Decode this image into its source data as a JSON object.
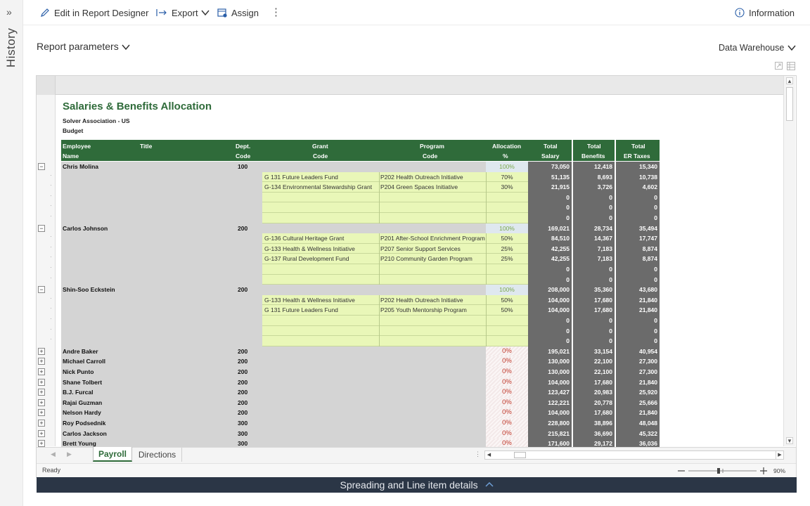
{
  "history": {
    "label": "History",
    "expand_icon": "double-chevron-right-icon"
  },
  "toolbar": {
    "edit_label": "Edit in Report Designer",
    "export_label": "Export",
    "assign_label": "Assign",
    "more_icon": "more-vertical-icon",
    "info_label": "Information"
  },
  "params": {
    "report_params_label": "Report parameters",
    "data_source_label": "Data Warehouse"
  },
  "report": {
    "title": "Salaries & Benefits Allocation",
    "org": "Solver Association - US",
    "scenario": "Budget",
    "headers": {
      "employee": [
        "Employee",
        "Name"
      ],
      "title": "Title",
      "dept": [
        "Dept.",
        "Code"
      ],
      "grant": [
        "Grant",
        "Code"
      ],
      "program": [
        "Program",
        "Code"
      ],
      "allocation": [
        "Allocation",
        "%"
      ],
      "salary": [
        "Total",
        "Salary"
      ],
      "benefits": [
        "Total",
        "Benefits"
      ],
      "taxes": [
        "Total",
        "ER Taxes"
      ]
    },
    "rows": [
      {
        "type": "emp",
        "name": "Chris Molina",
        "dept": "100",
        "alloc": "100%",
        "salary": "73,050",
        "benefits": "12,418",
        "taxes": "15,340"
      },
      {
        "type": "det",
        "grant": "G 131 Future Leaders Fund",
        "program": "P202 Health Outreach Initiative",
        "alloc": "70%",
        "salary": "51,135",
        "benefits": "8,693",
        "taxes": "10,738"
      },
      {
        "type": "det",
        "grant": "G-134 Environmental Stewardship Grant",
        "program": "P204 Green Spaces Initiative",
        "alloc": "30%",
        "salary": "21,915",
        "benefits": "3,726",
        "taxes": "4,602"
      },
      {
        "type": "det",
        "grant": "",
        "program": "",
        "alloc": "",
        "salary": "0",
        "benefits": "0",
        "taxes": "0"
      },
      {
        "type": "det",
        "grant": "",
        "program": "",
        "alloc": "",
        "salary": "0",
        "benefits": "0",
        "taxes": "0"
      },
      {
        "type": "det",
        "grant": "",
        "program": "",
        "alloc": "",
        "salary": "0",
        "benefits": "0",
        "taxes": "0"
      },
      {
        "type": "emp",
        "name": "Carlos Johnson",
        "dept": "200",
        "alloc": "100%",
        "salary": "169,021",
        "benefits": "28,734",
        "taxes": "35,494"
      },
      {
        "type": "det",
        "grant": "G-136 Cultural Heritage Grant",
        "program": "P201 After-School Enrichment Program",
        "alloc": "50%",
        "salary": "84,510",
        "benefits": "14,367",
        "taxes": "17,747"
      },
      {
        "type": "det",
        "grant": "G-133 Health & Wellness Initiative",
        "program": "P207 Senior Support Services",
        "alloc": "25%",
        "salary": "42,255",
        "benefits": "7,183",
        "taxes": "8,874"
      },
      {
        "type": "det",
        "grant": "G-137 Rural Development Fund",
        "program": "P210 Community Garden Program",
        "alloc": "25%",
        "salary": "42,255",
        "benefits": "7,183",
        "taxes": "8,874"
      },
      {
        "type": "det",
        "grant": "",
        "program": "",
        "alloc": "",
        "salary": "0",
        "benefits": "0",
        "taxes": "0"
      },
      {
        "type": "det",
        "grant": "",
        "program": "",
        "alloc": "",
        "salary": "0",
        "benefits": "0",
        "taxes": "0"
      },
      {
        "type": "emp",
        "name": "Shin-Soo Eckstein",
        "dept": "200",
        "alloc": "100%",
        "salary": "208,000",
        "benefits": "35,360",
        "taxes": "43,680"
      },
      {
        "type": "det",
        "grant": "G-133 Health & Wellness Initiative",
        "program": "P202 Health Outreach Initiative",
        "alloc": "50%",
        "salary": "104,000",
        "benefits": "17,680",
        "taxes": "21,840"
      },
      {
        "type": "det",
        "grant": "G 131 Future Leaders Fund",
        "program": "P205 Youth Mentorship Program",
        "alloc": "50%",
        "salary": "104,000",
        "benefits": "17,680",
        "taxes": "21,840"
      },
      {
        "type": "det",
        "grant": "",
        "program": "",
        "alloc": "",
        "salary": "0",
        "benefits": "0",
        "taxes": "0"
      },
      {
        "type": "det",
        "grant": "",
        "program": "",
        "alloc": "",
        "salary": "0",
        "benefits": "0",
        "taxes": "0"
      },
      {
        "type": "det",
        "grant": "",
        "program": "",
        "alloc": "",
        "salary": "0",
        "benefits": "0",
        "taxes": "0"
      },
      {
        "type": "col",
        "name": "Andre Baker",
        "dept": "200",
        "alloc": "0%",
        "salary": "195,021",
        "benefits": "33,154",
        "taxes": "40,954"
      },
      {
        "type": "col",
        "name": "Michael Carroll",
        "dept": "200",
        "alloc": "0%",
        "salary": "130,000",
        "benefits": "22,100",
        "taxes": "27,300"
      },
      {
        "type": "col",
        "name": "Nick Punto",
        "dept": "200",
        "alloc": "0%",
        "salary": "130,000",
        "benefits": "22,100",
        "taxes": "27,300"
      },
      {
        "type": "col",
        "name": "Shane Tolbert",
        "dept": "200",
        "alloc": "0%",
        "salary": "104,000",
        "benefits": "17,680",
        "taxes": "21,840"
      },
      {
        "type": "col",
        "name": "B.J. Furcal",
        "dept": "200",
        "alloc": "0%",
        "salary": "123,427",
        "benefits": "20,983",
        "taxes": "25,920"
      },
      {
        "type": "col",
        "name": "Rajai Guzman",
        "dept": "200",
        "alloc": "0%",
        "salary": "122,221",
        "benefits": "20,778",
        "taxes": "25,666"
      },
      {
        "type": "col",
        "name": "Nelson Hardy",
        "dept": "200",
        "alloc": "0%",
        "salary": "104,000",
        "benefits": "17,680",
        "taxes": "21,840"
      },
      {
        "type": "col",
        "name": "Roy Podsednik",
        "dept": "300",
        "alloc": "0%",
        "salary": "228,800",
        "benefits": "38,896",
        "taxes": "48,048"
      },
      {
        "type": "col",
        "name": "Carlos Jackson",
        "dept": "300",
        "alloc": "0%",
        "salary": "215,821",
        "benefits": "36,690",
        "taxes": "45,322"
      },
      {
        "type": "col",
        "name": "Brett Young",
        "dept": "300",
        "alloc": "0%",
        "salary": "171,600",
        "benefits": "29,172",
        "taxes": "36,036"
      }
    ]
  },
  "tabs": [
    {
      "label": "Payroll",
      "active": true
    },
    {
      "label": "Directions",
      "active": false
    }
  ],
  "status": {
    "text": "Ready",
    "zoom": "90%"
  },
  "drawer": {
    "label": "Spreading and Line item details"
  },
  "colors": {
    "brand_green": "#2f6b3a",
    "detail_green": "#e9f7b8",
    "gray": "#d4d4d4",
    "dark_gray": "#6b6b6b",
    "alert_red": "#c0392b",
    "drawer_bg": "#2b3646"
  }
}
